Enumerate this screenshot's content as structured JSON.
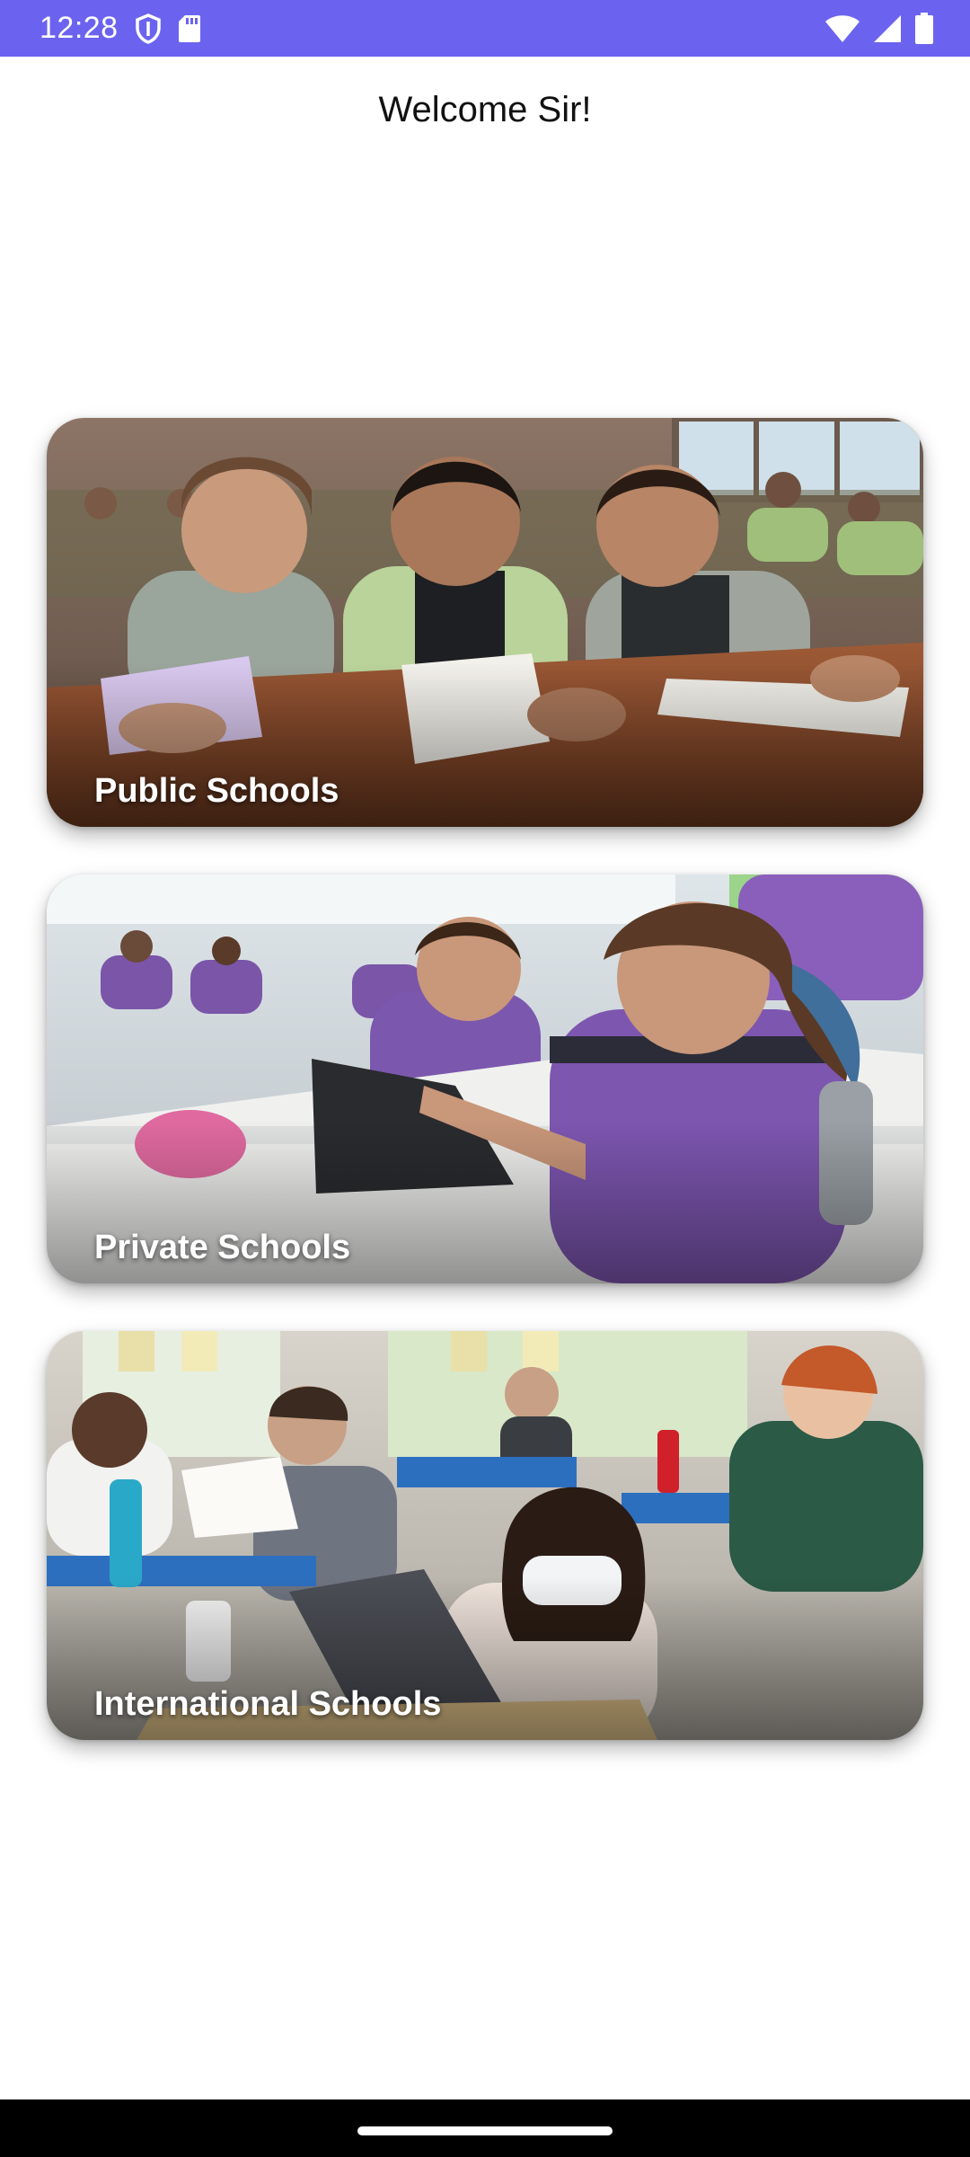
{
  "status_bar": {
    "time": "12:28",
    "icons": [
      "shield-icon",
      "sd-card-icon",
      "wifi-icon",
      "signal-icon",
      "battery-icon"
    ],
    "background": "#6b63ef"
  },
  "header": {
    "welcome": "Welcome Sir!"
  },
  "cards": [
    {
      "label": "Public Schools",
      "scene": "smiling students seated at wooden desk"
    },
    {
      "label": "Private Schools",
      "scene": "students in purple uniforms using tablets"
    },
    {
      "label": "International Schools",
      "scene": "masked students with laptops in classroom"
    }
  ],
  "nav": {
    "gesture": "home-indicator"
  }
}
